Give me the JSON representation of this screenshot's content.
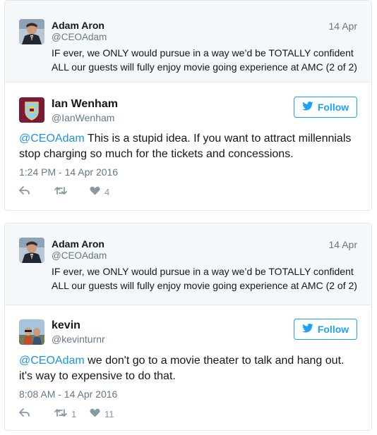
{
  "tweets": [
    {
      "quoted": {
        "name": "Adam Aron",
        "handle": "@CEOAdam",
        "date": "14 Apr",
        "text_line1": "IF ever, we ONLY would pursue in a way we’d be TOTALLY confident",
        "text_line2": "ALL our guests will fully enjoy movie going experience at AMC (2 of 2)"
      },
      "reply": {
        "name": "Ian Wenham",
        "handle": "@IanWenham",
        "follow_label": "Follow",
        "mention": "@CEOAdam",
        "text_line1_rest": " This is a stupid idea. If you want to attract millennials",
        "text_line2": "stop charging so much for the tickets and concessions.",
        "timestamp": "1:24 PM - 14 Apr 2016",
        "retweets": "",
        "likes": "4"
      }
    },
    {
      "quoted": {
        "name": "Adam Aron",
        "handle": "@CEOAdam",
        "date": "14 Apr",
        "text_line1": "IF ever, we ONLY would pursue in a way we’d be TOTALLY confident",
        "text_line2": "ALL our guests will fully enjoy movie going experience at AMC (2 of 2)"
      },
      "reply": {
        "name": "kevin",
        "handle": "@kevinturnr",
        "follow_label": "Follow",
        "mention": "@CEOAdam",
        "text_line1_rest": " we don't go to a movie theater to talk and hang out.",
        "text_line2": "it's way to expensive to do that.",
        "timestamp": "8:08 AM - 14 Apr 2016",
        "retweets": "1",
        "likes": "11"
      }
    }
  ],
  "colors": {
    "accent": "#1da1f2",
    "mention": "#1b95e0",
    "muted": "#657786",
    "icon": "#8899a6",
    "quoted_bg": "#f5f8fa"
  }
}
